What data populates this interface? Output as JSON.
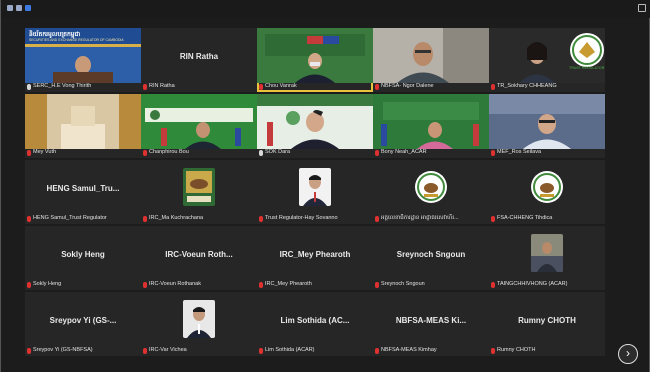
{
  "window": {
    "title": ""
  },
  "tiles": [
    {
      "id": "t1",
      "name": "SERC_H.E Vong Thirith",
      "center": "",
      "mic": "ok"
    },
    {
      "id": "t2",
      "name": "RIN Ratha",
      "center": "RIN Ratha",
      "mic": "muted"
    },
    {
      "id": "t3",
      "name": "Chou Vanrak",
      "center": "",
      "mic": "muted"
    },
    {
      "id": "t4",
      "name": "NBFSA- Ngor Dalene",
      "center": "",
      "mic": "muted"
    },
    {
      "id": "t5",
      "name": "TR_Sokhary CHHEANG",
      "center": "",
      "mic": "muted"
    },
    {
      "id": "t6",
      "name": "Mey Vuth",
      "center": "",
      "mic": "muted"
    },
    {
      "id": "t7",
      "name": "Chanphirou Bou",
      "center": "",
      "mic": "muted"
    },
    {
      "id": "t8",
      "name": "SOK Dara",
      "center": "",
      "mic": "ok"
    },
    {
      "id": "t9",
      "name": "Bony Neah_ACAR",
      "center": "",
      "mic": "muted"
    },
    {
      "id": "t10",
      "name": "MEF_Ros Seilava",
      "center": "",
      "mic": "muted"
    },
    {
      "id": "t11",
      "name": "HENG Samul_Trust Regulator",
      "center": "HENG Samul_Tru...",
      "mic": "muted"
    },
    {
      "id": "t12",
      "name": "IRC_Ma Kuchrachana",
      "center": "",
      "mic": "muted"
    },
    {
      "id": "t13",
      "name": "Trust Regulator-Hay Sovanno",
      "center": "",
      "mic": "muted"
    },
    {
      "id": "t14",
      "name": "អគ្គលេខាធិការដ្ឋាន អាជ្ញាធរសេវាហិរ...",
      "center": "",
      "mic": "muted"
    },
    {
      "id": "t15",
      "name": "FSA-CHHENG Tihdica",
      "center": "",
      "mic": "muted"
    },
    {
      "id": "t16",
      "name": "Sokly Heng",
      "center": "Sokly Heng",
      "mic": "muted"
    },
    {
      "id": "t17",
      "name": "IRC-Voeun Rothanak",
      "center": "IRC-Voeun Roth...",
      "mic": "muted"
    },
    {
      "id": "t18",
      "name": "IRC_Mey Phearoth",
      "center": "IRC_Mey Phearoth",
      "mic": "muted"
    },
    {
      "id": "t19",
      "name": "Sreynoch Sngoun",
      "center": "Sreynoch Sngoun",
      "mic": "muted"
    },
    {
      "id": "t20",
      "name": "TAINGCHHIVHONG (ACAR)",
      "center": "",
      "mic": "muted"
    },
    {
      "id": "t21",
      "name": "Sreypov Yi (GS-NBFSA)",
      "center": "Sreypov Yi (GS-...",
      "mic": "muted"
    },
    {
      "id": "t22",
      "name": "IRC-Var Vichea",
      "center": "",
      "mic": "muted"
    },
    {
      "id": "t23",
      "name": "Lim Sothida (ACAR)",
      "center": "Lim Sothida (AC...",
      "mic": "muted"
    },
    {
      "id": "t24",
      "name": "NBFSA-MEAS Kimhay",
      "center": "NBFSA-MEAS Ki...",
      "mic": "muted"
    },
    {
      "id": "t25",
      "name": "Rumny CHOTH",
      "center": "Rumny CHOTH",
      "mic": "muted"
    }
  ],
  "banner": {
    "title_kh": "និយ័តករមូលបត្រកម្ពុជា",
    "title_en": "SECURITIES AND EXCHANGE REGULATOR OF CAMBODIA"
  },
  "logo": {
    "text": "TRUST REGULATOR"
  },
  "colors": {
    "speaking": "#e7c43b",
    "muted": "#e03131"
  },
  "nav": {
    "next": "›"
  }
}
